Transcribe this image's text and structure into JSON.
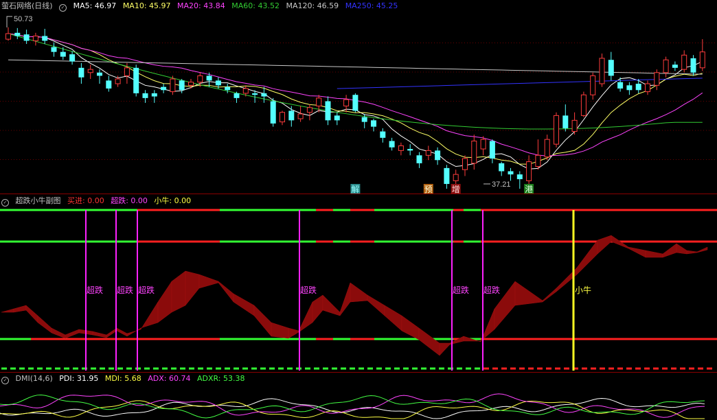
{
  "main": {
    "title": "萤石网络(日线)",
    "ma": [
      {
        "label": "MA5: 46.97",
        "color": "#ffffff"
      },
      {
        "label": "MA10: 45.97",
        "color": "#ffff66"
      },
      {
        "label": "MA20: 43.84",
        "color": "#ff44ff"
      },
      {
        "label": "MA60: 43.52",
        "color": "#33cc33"
      },
      {
        "label": "MA120: 46.59",
        "color": "#c8c8c8"
      },
      {
        "label": "MA250: 45.25",
        "color": "#3333ff"
      }
    ],
    "high_label": "50.73",
    "low_label": "37.21",
    "signals": [
      {
        "text": "解",
        "bg": "#2a8a8a",
        "color": "#9ff",
        "idx": 38
      },
      {
        "text": "预",
        "bg": "#b06010",
        "color": "#ffd",
        "idx": 46
      },
      {
        "text": "增",
        "bg": "#8b1010",
        "color": "#fdd",
        "idx": 49
      },
      {
        "text": "港",
        "bg": "#1a7a1a",
        "color": "#dfd",
        "idx": 57
      }
    ]
  },
  "sub": {
    "title": "超跌小牛副图",
    "items": [
      {
        "label": "买进: 0.00",
        "color": "#ff3333"
      },
      {
        "label": "超跌: 0.00",
        "color": "#ff44ff"
      },
      {
        "label": "小牛: 0.00",
        "color": "#ffff44"
      }
    ],
    "chaodie_label": "超跌",
    "xiaoniu_label": "小牛"
  },
  "dmi": {
    "title": "DMI(14,6)",
    "items": [
      {
        "label": "PDI: 31.95",
        "color": "#ffffff"
      },
      {
        "label": "MDI: 5.68",
        "color": "#ffff44"
      },
      {
        "label": "ADX: 60.74",
        "color": "#ff44ff"
      },
      {
        "label": "ADXR: 53.38",
        "color": "#44ff44"
      }
    ]
  },
  "chart_data": {
    "type": "candlestick",
    "candles": [
      [
        48.8,
        49.5,
        48.6,
        50.3
      ],
      [
        49.6,
        49.2,
        48.8,
        50.2
      ],
      [
        49.4,
        48.6,
        48.2,
        50.0
      ],
      [
        48.6,
        49.2,
        48.0,
        49.6
      ],
      [
        49.2,
        48.6,
        48.2,
        50.1
      ],
      [
        47.8,
        47.2,
        46.6,
        48.4
      ],
      [
        47.2,
        46.6,
        46.2,
        47.8
      ],
      [
        46.9,
        46.0,
        45.6,
        47.3
      ],
      [
        45.2,
        44.0,
        43.2,
        45.8
      ],
      [
        44.6,
        45.0,
        43.8,
        45.6
      ],
      [
        44.6,
        44.2,
        43.2,
        45.0
      ],
      [
        43.6,
        42.6,
        42.2,
        44.2
      ],
      [
        43.2,
        43.8,
        42.8,
        44.2
      ],
      [
        44.2,
        45.2,
        43.2,
        45.8
      ],
      [
        45.2,
        42.0,
        41.6,
        45.6
      ],
      [
        42.0,
        41.4,
        40.8,
        42.4
      ],
      [
        42.0,
        41.6,
        40.8,
        42.4
      ],
      [
        42.8,
        42.4,
        42.0,
        43.2
      ],
      [
        42.2,
        43.8,
        41.8,
        44.2
      ],
      [
        43.6,
        42.4,
        42.0,
        43.8
      ],
      [
        43.0,
        43.4,
        42.6,
        43.8
      ],
      [
        43.4,
        44.2,
        42.8,
        44.6
      ],
      [
        44.2,
        43.6,
        42.8,
        44.6
      ],
      [
        43.6,
        43.0,
        42.6,
        44.0
      ],
      [
        42.8,
        42.4,
        42.0,
        43.2
      ],
      [
        42.0,
        41.4,
        40.8,
        42.2
      ],
      [
        42.0,
        42.6,
        41.6,
        43.0
      ],
      [
        42.0,
        41.8,
        40.8,
        42.4
      ],
      [
        42.0,
        41.6,
        40.8,
        42.8
      ],
      [
        41.0,
        38.2,
        37.8,
        41.4
      ],
      [
        38.4,
        39.6,
        38.0,
        39.8
      ],
      [
        39.8,
        38.6,
        37.8,
        40.4
      ],
      [
        38.8,
        39.4,
        38.4,
        40.4
      ],
      [
        39.6,
        40.2,
        38.6,
        40.6
      ],
      [
        40.4,
        41.4,
        39.6,
        41.8
      ],
      [
        41.0,
        38.6,
        38.0,
        41.6
      ],
      [
        39.2,
        38.6,
        38.0,
        39.6
      ],
      [
        40.4,
        41.2,
        39.6,
        41.8
      ],
      [
        41.8,
        39.8,
        39.6,
        42.0
      ],
      [
        39.0,
        38.4,
        37.6,
        39.4
      ],
      [
        38.6,
        37.8,
        37.2,
        38.8
      ],
      [
        37.2,
        36.4,
        35.8,
        37.6
      ],
      [
        36.0,
        35.2,
        34.8,
        36.4
      ],
      [
        34.8,
        35.4,
        34.2,
        35.8
      ],
      [
        35.0,
        34.8,
        34.2,
        35.6
      ],
      [
        34.2,
        33.2,
        32.6,
        34.6
      ],
      [
        34.2,
        34.8,
        33.6,
        35.4
      ],
      [
        34.8,
        33.6,
        33.0,
        35.2
      ],
      [
        32.6,
        30.6,
        30.0,
        33.0
      ],
      [
        31.0,
        31.8,
        30.4,
        32.4
      ],
      [
        32.4,
        33.8,
        31.6,
        34.2
      ],
      [
        33.2,
        36.0,
        32.4,
        36.8
      ],
      [
        35.0,
        36.2,
        34.2,
        36.6
      ],
      [
        36.0,
        33.8,
        33.2,
        36.2
      ],
      [
        33.2,
        32.2,
        31.6,
        33.4
      ],
      [
        32.2,
        31.8,
        31.0,
        32.6
      ],
      [
        31.8,
        31.2,
        30.0,
        32.2
      ],
      [
        31.0,
        33.4,
        30.6,
        34.2
      ],
      [
        32.8,
        34.2,
        32.4,
        36.2
      ],
      [
        34.0,
        36.2,
        33.6,
        36.8
      ],
      [
        35.6,
        39.2,
        35.2,
        39.6
      ],
      [
        39.2,
        37.6,
        37.2,
        40.6
      ],
      [
        37.2,
        38.6,
        36.8,
        39.6
      ],
      [
        39.2,
        41.8,
        39.0,
        42.2
      ],
      [
        41.8,
        44.2,
        41.2,
        44.6
      ],
      [
        43.2,
        46.4,
        42.8,
        47.0
      ],
      [
        46.2,
        44.2,
        43.6,
        47.2
      ],
      [
        43.4,
        42.6,
        42.2,
        44.0
      ],
      [
        43.0,
        42.4,
        41.8,
        43.4
      ],
      [
        43.2,
        42.4,
        42.0,
        43.8
      ],
      [
        42.2,
        43.2,
        41.8,
        43.6
      ],
      [
        43.0,
        44.6,
        42.4,
        45.0
      ],
      [
        44.6,
        46.2,
        44.0,
        46.6
      ],
      [
        45.6,
        45.2,
        44.8,
        46.0
      ],
      [
        45.0,
        46.8,
        44.6,
        47.4
      ],
      [
        46.4,
        44.6,
        44.2,
        46.8
      ],
      [
        45.2,
        47.2,
        44.8,
        48.8
      ]
    ],
    "ylim": [
      30.0,
      52.0
    ],
    "high_value": 50.73,
    "low_value": 37.21
  }
}
